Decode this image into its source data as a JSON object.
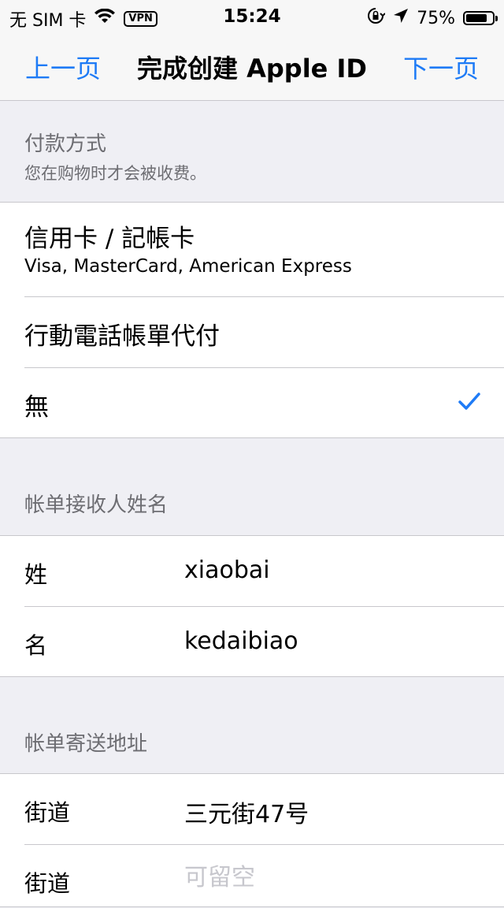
{
  "status_bar": {
    "carrier": "无 SIM 卡",
    "vpn": "VPN",
    "time": "15:24",
    "battery": "75%",
    "icons": [
      "wifi-icon",
      "vpn-badge",
      "rotation-lock-icon",
      "location-arrow-icon",
      "battery-icon"
    ]
  },
  "nav": {
    "back": "上一页",
    "title": "完成创建 Apple ID",
    "next": "下一页",
    "accent": "#1e7bf6"
  },
  "payment": {
    "header": "付款方式",
    "subheader": "您在购物时才会被收费。",
    "options": [
      {
        "title": "信用卡 / 記帳卡",
        "subtitle": "Visa, MasterCard, American Express"
      },
      {
        "title": "行動電話帳單代付"
      },
      {
        "title": "無",
        "selected": true
      }
    ]
  },
  "billing_name": {
    "header": "帐单接收人姓名",
    "fields": [
      {
        "label": "姓",
        "value": "xiaobai"
      },
      {
        "label": "名",
        "value": "kedaibiao"
      }
    ]
  },
  "billing_address": {
    "header": "帐单寄送地址",
    "fields": [
      {
        "label": "街道",
        "value": "三元街47号"
      },
      {
        "label": "街道",
        "placeholder": "可留空"
      }
    ]
  }
}
